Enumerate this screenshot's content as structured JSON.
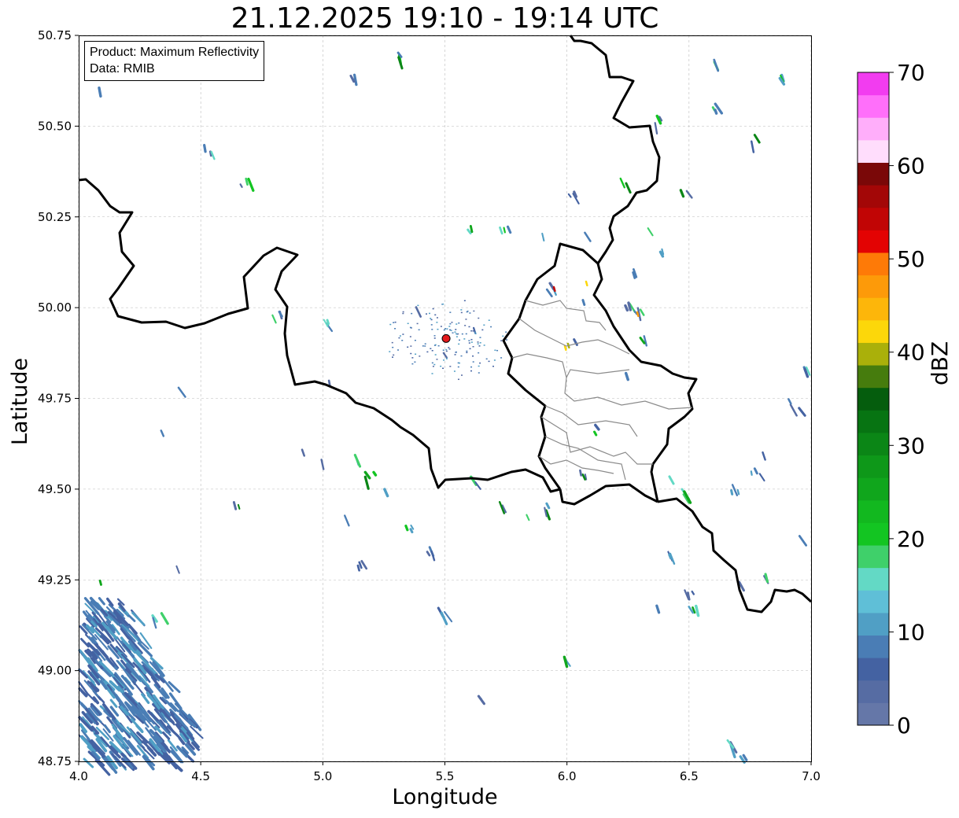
{
  "title": "21.12.2025 19:10 - 19:14 UTC",
  "legend": {
    "product": "Product: Maximum Reflectivity",
    "source": "Data: RMIB"
  },
  "axes": {
    "xlabel": "Longitude",
    "ylabel": "Latitude",
    "xlim": [
      4.0,
      7.0
    ],
    "ylim": [
      48.75,
      50.75
    ],
    "xticks": [
      "4.0",
      "4.5",
      "5.0",
      "5.5",
      "6.0",
      "6.5",
      "7.0"
    ],
    "yticks": [
      "48.75",
      "49.00",
      "49.25",
      "49.50",
      "49.75",
      "50.00",
      "50.25",
      "50.50",
      "50.75"
    ],
    "grid": true
  },
  "colorbar": {
    "label": "dBZ",
    "ticks": [
      "0",
      "10",
      "20",
      "30",
      "40",
      "50",
      "60",
      "70"
    ],
    "range": [
      0,
      70
    ],
    "colors": [
      "#6577a8",
      "#566ca3",
      "#4462a2",
      "#4a7db5",
      "#509fc5",
      "#5fbfd7",
      "#63d9c5",
      "#3fd06a",
      "#13c522",
      "#12b81f",
      "#10a61c",
      "#0e9819",
      "#0b8616",
      "#077412",
      "#055d0d",
      "#467c0d",
      "#aab00a",
      "#fcd70a",
      "#fdb60a",
      "#fd9a09",
      "#fe7a07",
      "#e30303",
      "#c10505",
      "#a30707",
      "#7a0808",
      "#ffddfc",
      "#ffaefa",
      "#ff6ffa",
      "#f23cf0"
    ]
  },
  "radar_site": {
    "lon": 5.505,
    "lat": 49.915,
    "color": "#e41a1c"
  },
  "map": {
    "border_color": "#000000",
    "admin_color": "#8a8a8a"
  }
}
